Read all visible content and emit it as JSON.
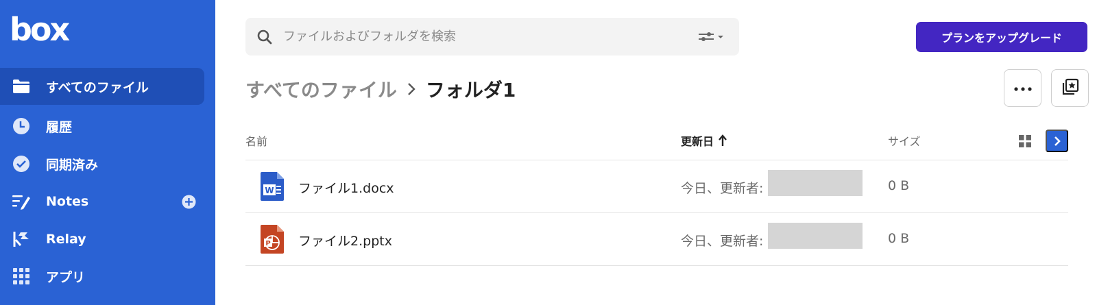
{
  "brand": {
    "logo_text": "box"
  },
  "sidebar": {
    "items": [
      {
        "label": "すべてのファイル",
        "icon": "folder-icon",
        "active": true
      },
      {
        "label": "履歴",
        "icon": "clock-icon"
      },
      {
        "label": "同期済み",
        "icon": "check-circle-icon"
      },
      {
        "label": "Notes",
        "icon": "notes-icon"
      },
      {
        "label": "Relay",
        "icon": "relay-icon"
      },
      {
        "label": "アプリ",
        "icon": "apps-grid-icon"
      }
    ]
  },
  "search": {
    "placeholder": "ファイルおよびフォルダを検索",
    "value": ""
  },
  "header": {
    "upgrade_label": "プランをアップグレード"
  },
  "breadcrumb": {
    "root": "すべてのファイル",
    "current": "フォルダ1"
  },
  "table": {
    "columns": {
      "name": "名前",
      "modified": "更新日",
      "size": "サイズ"
    },
    "sort": {
      "column": "modified",
      "direction": "ascending"
    },
    "rows": [
      {
        "name": "ファイル1.docx",
        "type": "word",
        "modified": "今日、更新者:",
        "size": "0 B"
      },
      {
        "name": "ファイル2.pptx",
        "type": "powerpoint",
        "modified": "今日、更新者:",
        "size": "0 B"
      }
    ]
  },
  "colors": {
    "sidebar": "#2a62d4",
    "sidebar_active": "#1f4fb6",
    "upgrade_button": "#4326c2",
    "word": "#2b5cc8",
    "powerpoint": "#c44523"
  }
}
